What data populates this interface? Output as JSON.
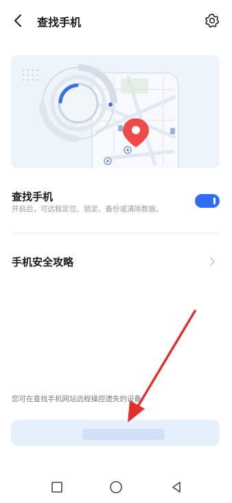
{
  "header": {
    "title": "查找手机"
  },
  "find_phone": {
    "title": "查找手机",
    "description": "开启后，可远程定位、锁定、备份或清除数据。",
    "toggle_on": true
  },
  "guide": {
    "title": "手机安全攻略"
  },
  "remote": {
    "note": "您可在查找手机网站远程操控遗失的设备:",
    "link_text": ""
  },
  "colors": {
    "accent": "#2f6ef0",
    "pin": "#ef4a4a",
    "annotation": "#e52e2e"
  },
  "icons": [
    "back-arrow-icon",
    "gear-icon",
    "chevron-right-icon",
    "map-pin-icon",
    "square-icon",
    "circle-icon",
    "triangle-back-icon"
  ]
}
